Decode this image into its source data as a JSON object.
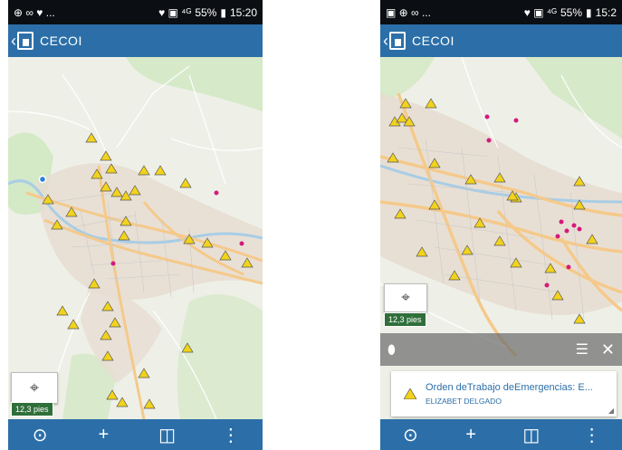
{
  "left": {
    "status": {
      "icons_left": "⊕ ∞ ♥ ...",
      "icons_right": "♥ ▣ ⁴ᴳ",
      "battery": "55%",
      "time": "15:20"
    },
    "appbar": {
      "back": "‹",
      "title": "CECOI"
    },
    "scale": "12,3 pies",
    "toolbar": {
      "locate": "⊙",
      "add": "+",
      "layers": "◫",
      "more": "⋮"
    }
  },
  "right": {
    "status": {
      "icons_left": "▣ ⊕ ∞ ...",
      "icons_right": "♥ ▣ ⁴ᴳ",
      "battery": "55%",
      "time": "15:2"
    },
    "appbar": {
      "back": "‹",
      "title": "CECOI"
    },
    "scale": "12,3 pies",
    "popup": {
      "title": "Orden deTrabajo deEmergencias: E...",
      "subtitle": "ELIZABET DELGADO"
    },
    "toolbar": {
      "locate": "⊙",
      "add": "+",
      "layers": "◫",
      "more": "⋮"
    }
  },
  "colors": {
    "accent": "#2c6fa8",
    "status_bg": "#0b0e12",
    "scale_bg": "#2f6f3a",
    "warning": "#f2d31a"
  }
}
